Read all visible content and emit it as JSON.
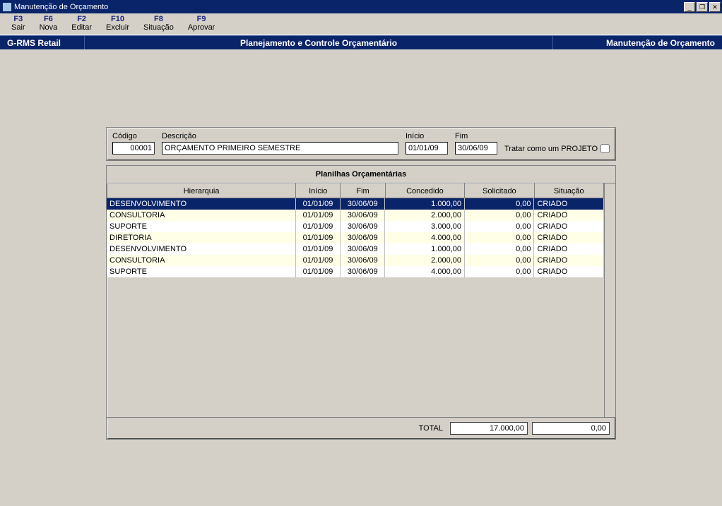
{
  "window": {
    "title": "Manutenção de Orçamento"
  },
  "menu": [
    {
      "key": "F3",
      "label": "Sair"
    },
    {
      "key": "F6",
      "label": "Nova"
    },
    {
      "key": "F2",
      "label": "Editar"
    },
    {
      "key": "F10",
      "label": "Excluir"
    },
    {
      "key": "F8",
      "label": "Situação"
    },
    {
      "key": "F9",
      "label": "Aprovar"
    }
  ],
  "bluebar": {
    "left": "G-RMS Retail",
    "center": "Planejamento e Controle Orçamentário",
    "right": "Manutenção de Orçamento"
  },
  "form": {
    "codigo_label": "Código",
    "codigo_value": "00001",
    "descricao_label": "Descrição",
    "descricao_value": "ORÇAMENTO PRIMEIRO SEMESTRE",
    "inicio_label": "Início",
    "inicio_value": "01/01/09",
    "fim_label": "Fim",
    "fim_value": "30/06/09",
    "projeto_label": "Tratar como um PROJETO"
  },
  "grid": {
    "title": "Planilhas Orçamentárias",
    "columns": {
      "hierarquia": "Hierarquia",
      "inicio": "Início",
      "fim": "Fim",
      "concedido": "Concedido",
      "solicitado": "Solicitado",
      "situacao": "Situação"
    },
    "rows": [
      {
        "hierarquia": "DESENVOLVIMENTO",
        "inicio": "01/01/09",
        "fim": "30/06/09",
        "concedido": "1.000,00",
        "solicitado": "0,00",
        "situacao": "CRIADO"
      },
      {
        "hierarquia": "CONSULTORIA",
        "inicio": "01/01/09",
        "fim": "30/06/09",
        "concedido": "2.000,00",
        "solicitado": "0,00",
        "situacao": "CRIADO"
      },
      {
        "hierarquia": "SUPORTE",
        "inicio": "01/01/09",
        "fim": "30/06/09",
        "concedido": "3.000,00",
        "solicitado": "0,00",
        "situacao": "CRIADO"
      },
      {
        "hierarquia": "DIRETORIA",
        "inicio": "01/01/09",
        "fim": "30/06/09",
        "concedido": "4.000,00",
        "solicitado": "0,00",
        "situacao": "CRIADO"
      },
      {
        "hierarquia": "DESENVOLVIMENTO",
        "inicio": "01/01/09",
        "fim": "30/06/09",
        "concedido": "1.000,00",
        "solicitado": "0,00",
        "situacao": "CRIADO"
      },
      {
        "hierarquia": "CONSULTORIA",
        "inicio": "01/01/09",
        "fim": "30/06/09",
        "concedido": "2.000,00",
        "solicitado": "0,00",
        "situacao": "CRIADO"
      },
      {
        "hierarquia": "SUPORTE",
        "inicio": "01/01/09",
        "fim": "30/06/09",
        "concedido": "4.000,00",
        "solicitado": "0,00",
        "situacao": "CRIADO"
      }
    ],
    "total_label": "TOTAL",
    "total_concedido": "17.000,00",
    "total_solicitado": "0,00"
  },
  "window_controls": {
    "min": "_",
    "max": "❐",
    "close": "✕"
  }
}
